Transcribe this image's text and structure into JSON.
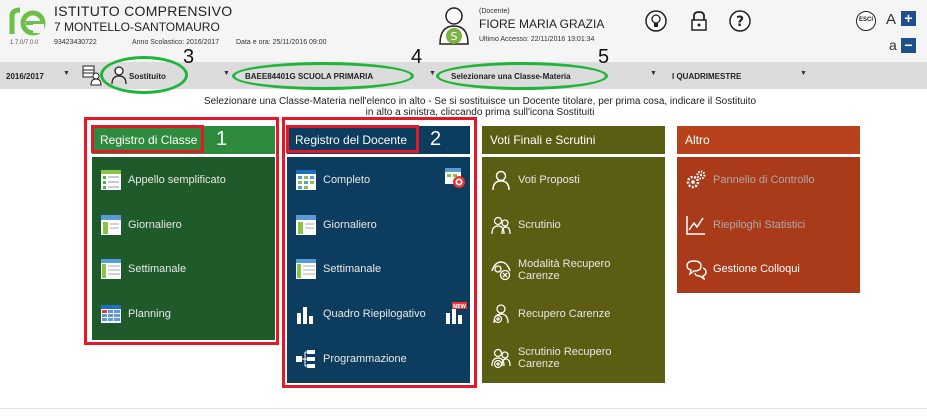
{
  "header": {
    "app_logo": "re",
    "version": "1.7.0/7.0.0",
    "school_name": "ISTITUTO COMPRENSIVO",
    "school_city": "7 MONTELLO-SANTOMAURO",
    "school_code": "93423430722",
    "school_year": "Anno Scolastico: 2016/2017",
    "date_time": "Data e ora: 25/11/2016 09:00",
    "avatar_letter": "S",
    "role": "(Docente)",
    "teacher_name": "FIORE MARIA GRAZIA",
    "last_access": "Ultimo Accesso: 22/11/2016 13:01:34",
    "icons": [
      "lightbulb-icon",
      "lock-icon",
      "help-icon"
    ],
    "logout": "ESCI",
    "font_large": "A",
    "font_small": "a",
    "plus": "+",
    "minus": "−"
  },
  "selectors": {
    "year": "2016/2017",
    "substitute": "Sostituito",
    "class": "BAEE84401G SCUOLA PRIMARIA",
    "class_subject": "Selezionare una Classe-Materia",
    "period": "I QUADRIMESTRE",
    "arrow": "▼"
  },
  "annotations": {
    "n1": "1",
    "n2": "2",
    "n3": "3",
    "n4": "4",
    "n5": "5"
  },
  "instruction": {
    "line1": "Selezionare una Classe-Materia nell'elenco in alto - Se si sostituisce un Docente titolare, per prima cosa, indicare il Sostituito",
    "line2": "in alto a sinistra, cliccando prima sull'icona Sostituiti"
  },
  "cards": {
    "registro_classe": {
      "title": "Registro di Classe",
      "items": [
        "Appello semplificato",
        "Giornaliero",
        "Settimanale",
        "Planning"
      ]
    },
    "registro_docente": {
      "title": "Registro del Docente",
      "items": [
        "Completo",
        "Giornaliero",
        "Settimanale",
        "Quadro Riepilogativo",
        "Programmazione"
      ],
      "new_badge": "NEW"
    },
    "voti_finali": {
      "title": "Voti Finali e Scrutini",
      "items": [
        "Voti Proposti",
        "Scrutinio",
        "Modalità Recupero\nCarenze",
        "Recupero Carenze",
        "Scrutinio Recupero\nCarenze"
      ]
    },
    "altro": {
      "title": "Altro",
      "items": [
        "Pannello di Controllo",
        "Riepiloghi Statistici",
        "Gestione Colloqui"
      ]
    }
  },
  "colors": {
    "green_head": "#2e8b3e",
    "green_body": "#1e5a2a",
    "blue": "#0c3d5e",
    "olive": "#5a5d12",
    "rust_head": "#b8421c",
    "rust_body": "#a93a1a",
    "annotation_red": "#e3192a",
    "annotation_green": "#1eb53a"
  }
}
